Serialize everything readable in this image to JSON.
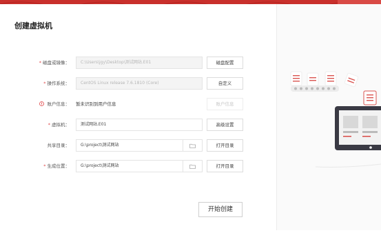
{
  "title": "创建虚拟机",
  "rows": [
    {
      "label": "磁盘或镜像：",
      "value": "C:\\Users\\jgy\\Desktop\\测试网站.E01",
      "button": "磁盘配置"
    },
    {
      "label": "操作系统：",
      "value": "CentOS Linux release 7.6.1810 (Core)",
      "button": "自定义"
    },
    {
      "label": "账户信息：",
      "value": "暂未识别到用户信息",
      "button": "账户信息"
    },
    {
      "label": "虚拟机：",
      "value": "测试网站.E01",
      "button": "高级设置"
    },
    {
      "label": "共享目录：",
      "value": "G:\\project\\测试网站",
      "button": "打开目录"
    },
    {
      "label": "生成位置：",
      "value": "G:\\project\\测试网站",
      "button": "打开目录"
    }
  ],
  "start_button": "开始创建",
  "icons": {
    "folder": "folder-icon",
    "warning": "warning-icon",
    "required": "required-asterisk"
  },
  "colors": {
    "accent": "#c9302c",
    "required": "#e0484a"
  }
}
